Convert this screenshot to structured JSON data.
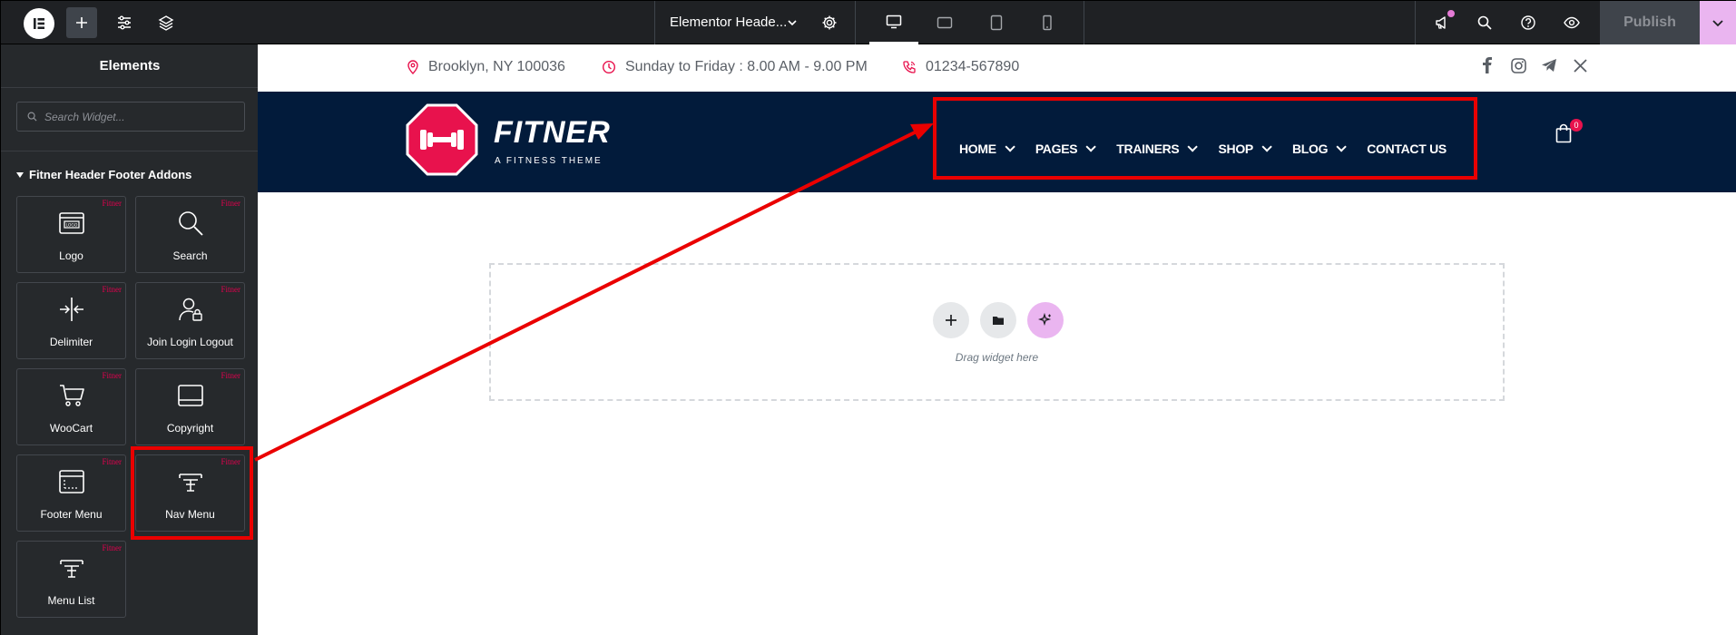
{
  "topbar": {
    "document_title": "Elementor Heade...",
    "publish_label": "Publish"
  },
  "panel": {
    "title": "Elements",
    "search_placeholder": "Search Widget...",
    "category": "Fitner Header Footer Addons",
    "widgets": [
      {
        "label": "Logo",
        "badge": "Fitner"
      },
      {
        "label": "Search",
        "badge": "Fitner"
      },
      {
        "label": "Delimiter",
        "badge": "Fitner"
      },
      {
        "label": "Join Login Logout",
        "badge": "Fitner"
      },
      {
        "label": "WooCart",
        "badge": "Fitner"
      },
      {
        "label": "Copyright",
        "badge": "Fitner"
      },
      {
        "label": "Footer Menu",
        "badge": "Fitner"
      },
      {
        "label": "Nav Menu",
        "badge": "Fitner"
      },
      {
        "label": "Menu List",
        "badge": "Fitner"
      }
    ]
  },
  "site": {
    "address": "Brooklyn, NY 100036",
    "hours": "Sunday to Friday : 8.00 AM - 9.00 PM",
    "phone": "01234-567890",
    "brand_name": "FITNER",
    "brand_tagline": "A FITNESS THEME",
    "nav": [
      "HOME",
      "PAGES",
      "TRAINERS",
      "SHOP",
      "BLOG",
      "CONTACT US"
    ],
    "cart_count": "0"
  },
  "canvas": {
    "drop_label": "Drag widget here"
  },
  "colors": {
    "accent_pink": "#e8124d",
    "header_navy": "#021b3b",
    "annotation_red": "#ea0000",
    "ai_purple": "#eab5f0"
  }
}
